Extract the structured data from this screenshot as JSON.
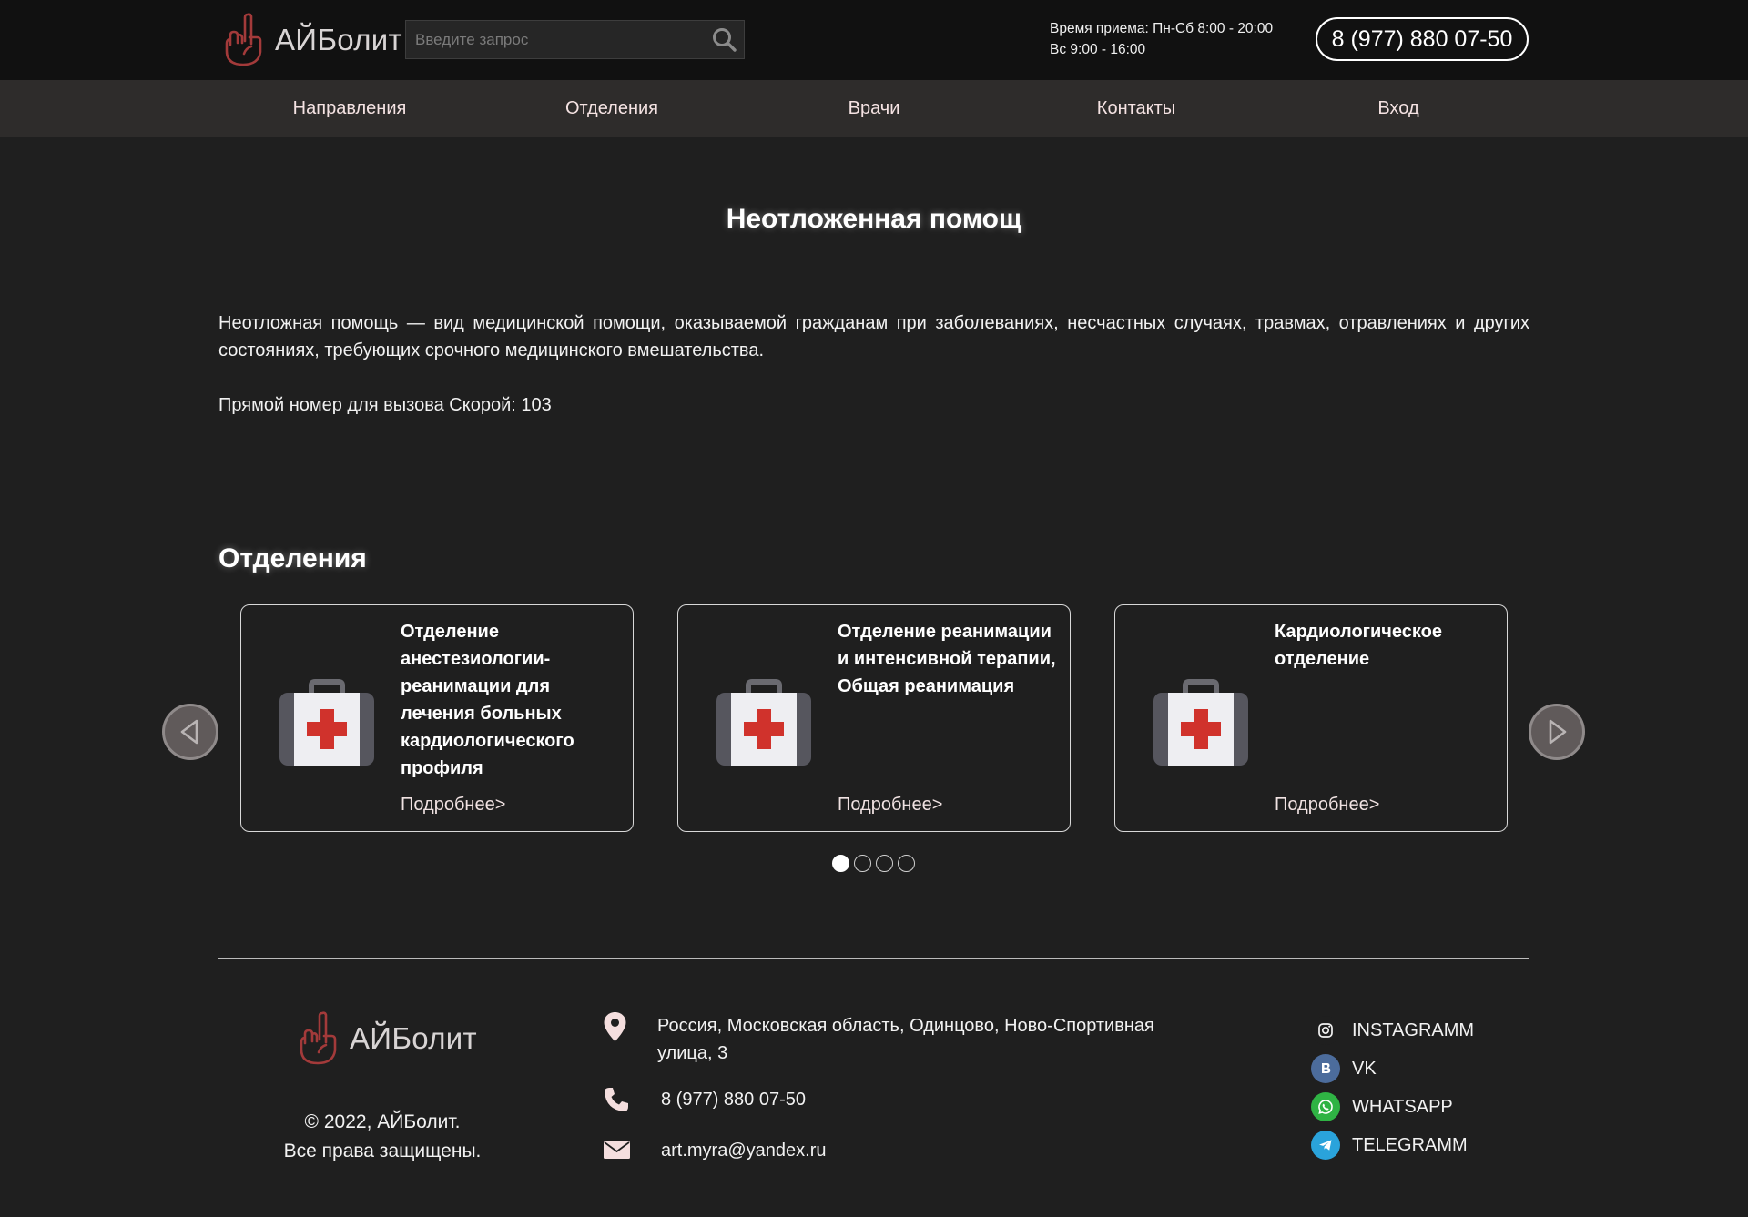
{
  "header": {
    "logo_text": "АЙБолит",
    "search_placeholder": "Введите запрос",
    "hours_line1": "Время приема: Пн-Сб 8:00 - 20:00",
    "hours_line2": "Вс 9:00 - 16:00",
    "phone": "8 (977) 880 07-50"
  },
  "nav": {
    "items": [
      {
        "label": "Направления"
      },
      {
        "label": "Отделения"
      },
      {
        "label": "Врачи"
      },
      {
        "label": "Контакты"
      },
      {
        "label": "Вход"
      }
    ]
  },
  "main": {
    "title": "Неотложенная помощ",
    "description": "Неотложная помощь — вид медицинской помощи, оказываемой гражданам при заболеваниях, несчастных случаях, травмах, отравлениях и других состояниях, требующих срочного медицинского вмешательства.",
    "direct_number": "Прямой номер для вызова Скорой: 103"
  },
  "departments": {
    "title": "Отделения",
    "cards": [
      {
        "title": "Отделение анестезиологии-реанимации для лечения больных кардиологического профиля",
        "more": "Подробнее>"
      },
      {
        "title": "Отделение реанимации и интенсивной терапии, Общая реанимация",
        "more": "Подробнее>"
      },
      {
        "title": "Кардиологическое отделение",
        "more": "Подробнее>"
      }
    ],
    "active_page": 1,
    "page_count": 4
  },
  "footer": {
    "logo_text": "АЙБолит",
    "copyright_line1": "© 2022, АЙБолит.",
    "copyright_line2": "Все права защищены.",
    "address": "Россия, Московская область, Одинцово, Ново-Спортивная улица, 3",
    "phone": "8 (977) 880 07-50",
    "email": "art.myra@yandex.ru",
    "socials": [
      {
        "label": "INSTAGRAMM",
        "icon": "instagram-icon",
        "color": "#1f1f1f"
      },
      {
        "label": "VK",
        "icon": "vk-icon",
        "color": "#4c6c9c"
      },
      {
        "label": "WHATSAPP",
        "icon": "whatsapp-icon",
        "color": "#2fb344"
      },
      {
        "label": "TELEGRAMM",
        "icon": "telegram-icon",
        "color": "#2aa3db"
      }
    ]
  },
  "colors": {
    "background": "#1f1f1f",
    "header": "#111111",
    "nav": "#2e2c2b",
    "logo_accent": "#a33a3a",
    "cross_red": "#d0322c"
  }
}
